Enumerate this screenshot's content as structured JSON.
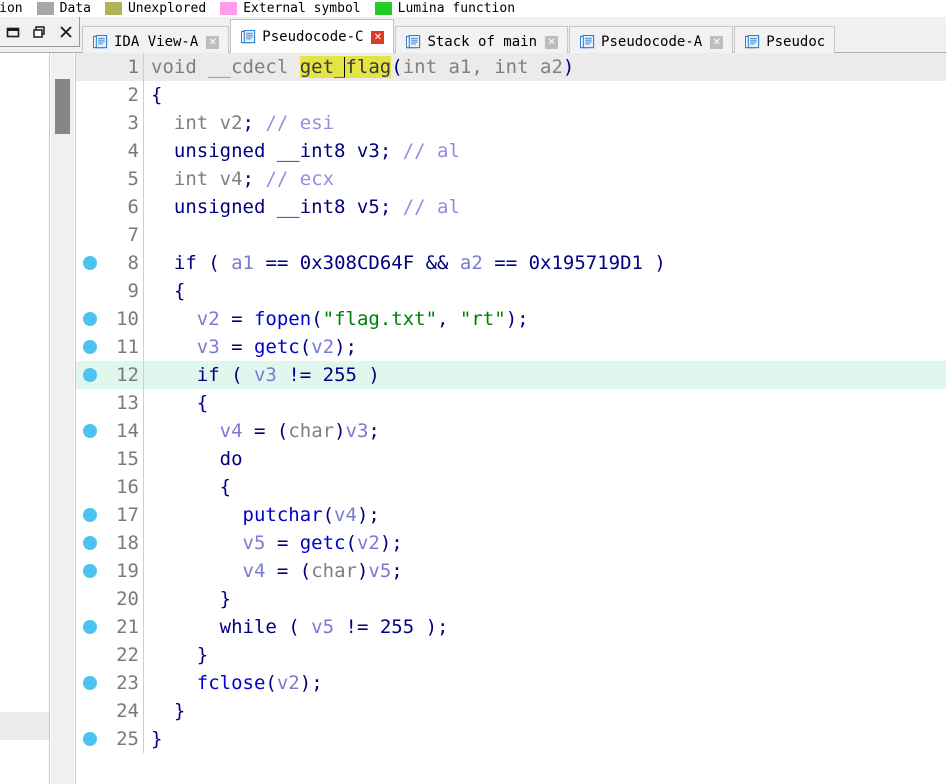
{
  "legend": {
    "entries": [
      {
        "label": "truction",
        "color": "",
        "no_swatch": true
      },
      {
        "label": "Data",
        "color": "#a8a8a8"
      },
      {
        "label": "Unexplored",
        "color": "#b2b25a"
      },
      {
        "label": "External symbol",
        "color": "#ff9cf0"
      },
      {
        "label": "Lumina function",
        "color": "#22cc22"
      }
    ]
  },
  "window_controls": {
    "minimize": "minimize",
    "restore": "restore",
    "close": "close"
  },
  "tabs": [
    {
      "label": "IDA View-A",
      "active": false,
      "close": "✕",
      "danger": false
    },
    {
      "label": "Pseudocode-C",
      "active": true,
      "close": "✕",
      "danger": true
    },
    {
      "label": "Stack of main",
      "active": false,
      "close": "✕",
      "danger": false
    },
    {
      "label": "Pseudocode-A",
      "active": false,
      "close": "✕",
      "danger": false
    },
    {
      "label": "Pseudoc",
      "active": false,
      "close": "",
      "danger": false
    }
  ],
  "code": {
    "function_name": "get_flag",
    "highlight_word": "get_flag",
    "lines": [
      {
        "n": "1",
        "bp": false,
        "hl": "first",
        "tokens": [
          {
            "t": "void ",
            "c": "t-plain"
          },
          {
            "t": "__cdecl ",
            "c": "t-plain"
          },
          {
            "t": "get_",
            "c": "hl-word"
          },
          {
            "t": "CARET",
            "c": "caret"
          },
          {
            "t": "flag",
            "c": "hl-word"
          },
          {
            "t": "(",
            "c": "t-punct"
          },
          {
            "t": "int",
            "c": "t-plain"
          },
          {
            "t": " a1, ",
            "c": "t-plain"
          },
          {
            "t": "int",
            "c": "t-plain"
          },
          {
            "t": " a2",
            "c": "t-plain"
          },
          {
            "t": ")",
            "c": "t-punct"
          }
        ]
      },
      {
        "n": "2",
        "bp": false,
        "hl": "",
        "tokens": [
          {
            "t": "{",
            "c": "t-punct"
          }
        ]
      },
      {
        "n": "3",
        "bp": false,
        "hl": "",
        "tokens": [
          {
            "t": "  ",
            "c": "t-plain"
          },
          {
            "t": "int",
            "c": "t-gray"
          },
          {
            "t": " v2",
            "c": "t-gray"
          },
          {
            "t": ";",
            "c": "t-punct"
          },
          {
            "t": " ",
            "c": "t-plain"
          },
          {
            "t": "// esi",
            "c": "t-cmt"
          }
        ]
      },
      {
        "n": "4",
        "bp": false,
        "hl": "",
        "tokens": [
          {
            "t": "  ",
            "c": "t-plain"
          },
          {
            "t": "unsigned __int8",
            "c": "t-kw"
          },
          {
            "t": " v3",
            "c": "t-kw"
          },
          {
            "t": ";",
            "c": "t-punct"
          },
          {
            "t": " ",
            "c": "t-plain"
          },
          {
            "t": "// al",
            "c": "t-cmt"
          }
        ]
      },
      {
        "n": "5",
        "bp": false,
        "hl": "",
        "tokens": [
          {
            "t": "  ",
            "c": "t-plain"
          },
          {
            "t": "int",
            "c": "t-gray"
          },
          {
            "t": " v4",
            "c": "t-gray"
          },
          {
            "t": ";",
            "c": "t-punct"
          },
          {
            "t": " ",
            "c": "t-plain"
          },
          {
            "t": "// ecx",
            "c": "t-cmt"
          }
        ]
      },
      {
        "n": "6",
        "bp": false,
        "hl": "",
        "tokens": [
          {
            "t": "  ",
            "c": "t-plain"
          },
          {
            "t": "unsigned __int8",
            "c": "t-kw"
          },
          {
            "t": " v5",
            "c": "t-kw"
          },
          {
            "t": ";",
            "c": "t-punct"
          },
          {
            "t": " ",
            "c": "t-plain"
          },
          {
            "t": "// al",
            "c": "t-cmt"
          }
        ]
      },
      {
        "n": "7",
        "bp": false,
        "hl": "",
        "tokens": []
      },
      {
        "n": "8",
        "bp": true,
        "hl": "",
        "tokens": [
          {
            "t": "  ",
            "c": "t-plain"
          },
          {
            "t": "if",
            "c": "t-kw"
          },
          {
            "t": " ( ",
            "c": "t-punct"
          },
          {
            "t": "a1",
            "c": "t-var"
          },
          {
            "t": " == ",
            "c": "t-punct"
          },
          {
            "t": "0x308CD64F",
            "c": "t-num"
          },
          {
            "t": " && ",
            "c": "t-punct"
          },
          {
            "t": "a2",
            "c": "t-var"
          },
          {
            "t": " == ",
            "c": "t-punct"
          },
          {
            "t": "0x195719D1",
            "c": "t-num"
          },
          {
            "t": " )",
            "c": "t-punct"
          }
        ]
      },
      {
        "n": "9",
        "bp": false,
        "hl": "",
        "tokens": [
          {
            "t": "  {",
            "c": "t-punct"
          }
        ]
      },
      {
        "n": "10",
        "bp": true,
        "hl": "",
        "tokens": [
          {
            "t": "    ",
            "c": "t-plain"
          },
          {
            "t": "v2",
            "c": "t-var"
          },
          {
            "t": " = ",
            "c": "t-punct"
          },
          {
            "t": "fopen",
            "c": "t-fn"
          },
          {
            "t": "(",
            "c": "t-punct"
          },
          {
            "t": "\"flag.txt\"",
            "c": "t-str"
          },
          {
            "t": ", ",
            "c": "t-punct"
          },
          {
            "t": "\"rt\"",
            "c": "t-str"
          },
          {
            "t": ");",
            "c": "t-punct"
          }
        ]
      },
      {
        "n": "11",
        "bp": true,
        "hl": "",
        "tokens": [
          {
            "t": "    ",
            "c": "t-plain"
          },
          {
            "t": "v3",
            "c": "t-var"
          },
          {
            "t": " = ",
            "c": "t-punct"
          },
          {
            "t": "getc",
            "c": "t-fn"
          },
          {
            "t": "(",
            "c": "t-punct"
          },
          {
            "t": "v2",
            "c": "t-var"
          },
          {
            "t": ");",
            "c": "t-punct"
          }
        ]
      },
      {
        "n": "12",
        "bp": true,
        "hl": "current",
        "tokens": [
          {
            "t": "    ",
            "c": "t-plain"
          },
          {
            "t": "if",
            "c": "t-kw"
          },
          {
            "t": " ( ",
            "c": "t-punct"
          },
          {
            "t": "v3",
            "c": "t-var"
          },
          {
            "t": " != ",
            "c": "t-punct"
          },
          {
            "t": "255",
            "c": "t-num"
          },
          {
            "t": " )",
            "c": "t-punct"
          }
        ]
      },
      {
        "n": "13",
        "bp": false,
        "hl": "",
        "tokens": [
          {
            "t": "    {",
            "c": "t-punct"
          }
        ]
      },
      {
        "n": "14",
        "bp": true,
        "hl": "",
        "tokens": [
          {
            "t": "      ",
            "c": "t-plain"
          },
          {
            "t": "v4",
            "c": "t-var"
          },
          {
            "t": " = ",
            "c": "t-punct"
          },
          {
            "t": "(",
            "c": "t-punct"
          },
          {
            "t": "char",
            "c": "t-gray"
          },
          {
            "t": ")",
            "c": "t-punct"
          },
          {
            "t": "v3",
            "c": "t-var"
          },
          {
            "t": ";",
            "c": "t-punct"
          }
        ]
      },
      {
        "n": "15",
        "bp": false,
        "hl": "",
        "tokens": [
          {
            "t": "      ",
            "c": "t-plain"
          },
          {
            "t": "do",
            "c": "t-kw"
          }
        ]
      },
      {
        "n": "16",
        "bp": false,
        "hl": "",
        "tokens": [
          {
            "t": "      {",
            "c": "t-punct"
          }
        ]
      },
      {
        "n": "17",
        "bp": true,
        "hl": "",
        "tokens": [
          {
            "t": "        ",
            "c": "t-plain"
          },
          {
            "t": "putchar",
            "c": "t-fn"
          },
          {
            "t": "(",
            "c": "t-punct"
          },
          {
            "t": "v4",
            "c": "t-var"
          },
          {
            "t": ");",
            "c": "t-punct"
          }
        ]
      },
      {
        "n": "18",
        "bp": true,
        "hl": "",
        "tokens": [
          {
            "t": "        ",
            "c": "t-plain"
          },
          {
            "t": "v5",
            "c": "t-var"
          },
          {
            "t": " = ",
            "c": "t-punct"
          },
          {
            "t": "getc",
            "c": "t-fn"
          },
          {
            "t": "(",
            "c": "t-punct"
          },
          {
            "t": "v2",
            "c": "t-var"
          },
          {
            "t": ");",
            "c": "t-punct"
          }
        ]
      },
      {
        "n": "19",
        "bp": true,
        "hl": "",
        "tokens": [
          {
            "t": "        ",
            "c": "t-plain"
          },
          {
            "t": "v4",
            "c": "t-var"
          },
          {
            "t": " = ",
            "c": "t-punct"
          },
          {
            "t": "(",
            "c": "t-punct"
          },
          {
            "t": "char",
            "c": "t-gray"
          },
          {
            "t": ")",
            "c": "t-punct"
          },
          {
            "t": "v5",
            "c": "t-var"
          },
          {
            "t": ";",
            "c": "t-punct"
          }
        ]
      },
      {
        "n": "20",
        "bp": false,
        "hl": "",
        "tokens": [
          {
            "t": "      }",
            "c": "t-punct"
          }
        ]
      },
      {
        "n": "21",
        "bp": true,
        "hl": "",
        "tokens": [
          {
            "t": "      ",
            "c": "t-plain"
          },
          {
            "t": "while",
            "c": "t-kw"
          },
          {
            "t": " ( ",
            "c": "t-punct"
          },
          {
            "t": "v5",
            "c": "t-var"
          },
          {
            "t": " != ",
            "c": "t-punct"
          },
          {
            "t": "255",
            "c": "t-num"
          },
          {
            "t": " );",
            "c": "t-punct"
          }
        ]
      },
      {
        "n": "22",
        "bp": false,
        "hl": "",
        "tokens": [
          {
            "t": "    }",
            "c": "t-punct"
          }
        ]
      },
      {
        "n": "23",
        "bp": true,
        "hl": "",
        "tokens": [
          {
            "t": "    ",
            "c": "t-plain"
          },
          {
            "t": "fclose",
            "c": "t-fn"
          },
          {
            "t": "(",
            "c": "t-punct"
          },
          {
            "t": "v2",
            "c": "t-var"
          },
          {
            "t": ");",
            "c": "t-punct"
          }
        ]
      },
      {
        "n": "24",
        "bp": false,
        "hl": "",
        "tokens": [
          {
            "t": "  }",
            "c": "t-punct"
          }
        ]
      },
      {
        "n": "25",
        "bp": true,
        "hl": "",
        "tokens": [
          {
            "t": "}",
            "c": "t-punct"
          }
        ]
      }
    ]
  }
}
